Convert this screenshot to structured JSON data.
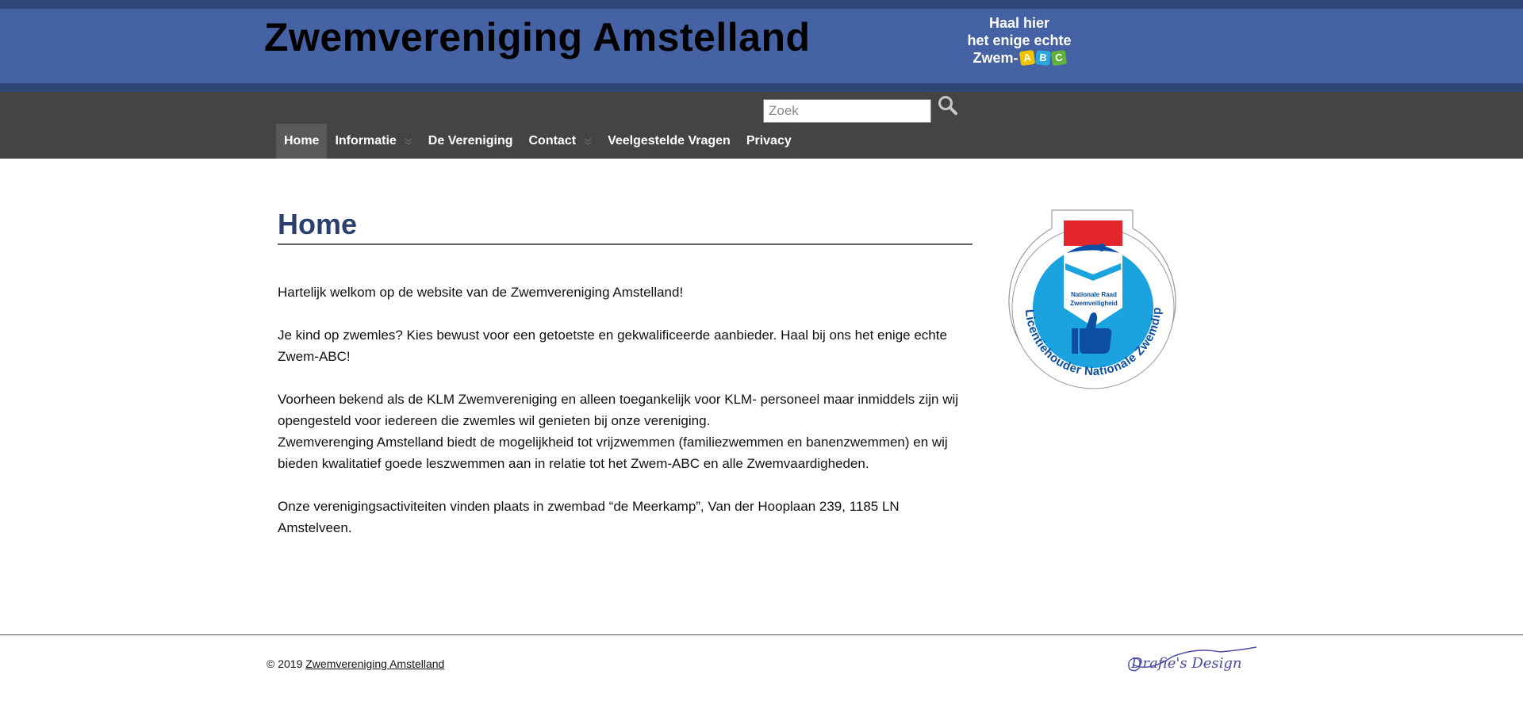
{
  "header": {
    "site_title": "Zwemvereniging Amstelland",
    "promo": {
      "line1": "Haal hier",
      "line2": "het enige echte",
      "line3_prefix": "Zwem-",
      "abc_letters": [
        "A",
        "B",
        "C"
      ]
    }
  },
  "search": {
    "placeholder": "Zoek",
    "value": ""
  },
  "nav": {
    "items": [
      {
        "label": "Home",
        "active": true,
        "has_dropdown": false
      },
      {
        "label": "Informatie",
        "active": false,
        "has_dropdown": true
      },
      {
        "label": "De Vereniging",
        "active": false,
        "has_dropdown": false
      },
      {
        "label": "Contact",
        "active": false,
        "has_dropdown": true
      },
      {
        "label": "Veelgestelde Vragen",
        "active": false,
        "has_dropdown": false
      },
      {
        "label": "Privacy",
        "active": false,
        "has_dropdown": false
      }
    ]
  },
  "main": {
    "title": "Home",
    "paragraphs": [
      "Hartelijk welkom op de website van de Zwemvereniging Amstelland!",
      "Je kind op zwemles? Kies bewust voor een getoetste en gekwalificeerde aanbieder. Haal bij ons het enige echte Zwem-ABC!",
      "Voorheen bekend als de KLM Zwemvereniging en alleen toegankelijk voor KLM- personeel maar inmiddels zijn wij opengesteld voor iedereen die zwemles wil genieten bij onze vereniging.",
      "Zwemverenging Amstelland biedt de mogelijkheid tot vrijzwemmen (familiezwemmen en banenzwemmen) en wij bieden kwalitatief goede leszwemmen aan in relatie tot het Zwem-ABC en alle Zwemvaardigheden.",
      "Onze verenigingsactiviteiten vinden plaats in zwembad “de Meerkamp”, Van der Hooplaan 239, 1185 LN Amstelveen."
    ]
  },
  "badge": {
    "inner_text_1": "Nationale Raad",
    "inner_text_2": "Zwemveiligheid",
    "ring_text": "Licentiehouder Nationale Zwemdiploma's"
  },
  "footer": {
    "copyright_prefix": "© 2019",
    "copyright_link": "Zwemvereniging Amstelland",
    "signature": "Drafie's Design"
  },
  "colors": {
    "header_dark": "#2e4577",
    "header": "#4562a4",
    "nav": "#444444",
    "nav_active": "#595959",
    "title": "#2b3f6f",
    "badge_blue": "#1aa3df",
    "badge_red": "#e3262b",
    "badge_navy": "#0b4ea2"
  }
}
